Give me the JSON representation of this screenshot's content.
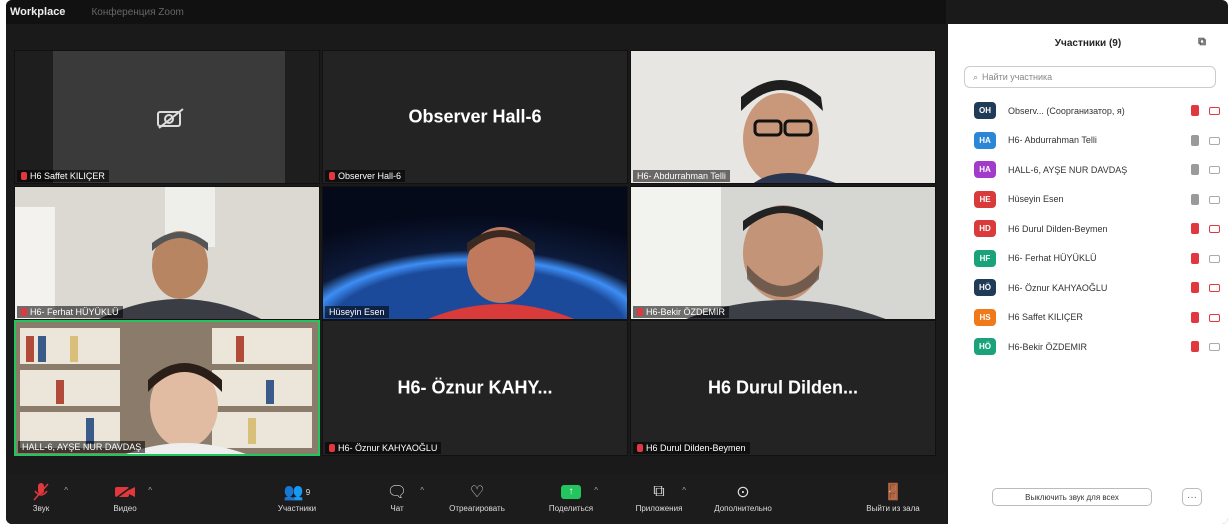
{
  "window": {
    "title": "Workplace",
    "meeting_title": "Конференция Zoom"
  },
  "tiles": [
    {
      "name": "H6 Saffet KILIÇER",
      "big": "",
      "camera_off_icon": "camera-off-icon"
    },
    {
      "name": "Observer Hall-6",
      "big": "Observer  Hall-6"
    },
    {
      "name": "H6- Abdurrahman Telli",
      "big": ""
    },
    {
      "name": "H6- Ferhat HÜYÜKLÜ",
      "big": ""
    },
    {
      "name": "Hüseyin Esen",
      "big": ""
    },
    {
      "name": "H6-Bekir ÖZDEMIR",
      "big": ""
    },
    {
      "name": "HALL-6, AYŞE NUR DAVDAŞ",
      "big": ""
    },
    {
      "name": "H6- Öznur KAHYAOĞLU",
      "big": "H6- Öznur KAHY..."
    },
    {
      "name": "H6 Durul Dilden-Beymen",
      "big": "H6 Durul Dilden..."
    }
  ],
  "toolbar": {
    "audio": "Звук",
    "video": "Видео",
    "participants": "Участники",
    "participants_count": "9",
    "chat": "Чат",
    "react": "Отреагировать",
    "share": "Поделиться",
    "apps": "Приложения",
    "more": "Дополнительно",
    "leave": "Выйти из зала"
  },
  "panel": {
    "title": "Участники (9)",
    "search_placeholder": "Найти участника",
    "mute_all": "Выключить звук для всех",
    "more": "···",
    "participants": [
      {
        "initials": "OH",
        "name": "Observ... (Соорганизатор, я)",
        "color": "#1f3b57",
        "muted": true,
        "cam_off": true
      },
      {
        "initials": "HA",
        "name": "H6- Abdurrahman Telli",
        "color": "#2b86d6",
        "muted": false,
        "cam_off": false
      },
      {
        "initials": "HA",
        "name": "HALL-6, AYŞE NUR DAVDAŞ",
        "color": "#a23bc9",
        "muted": false,
        "cam_off": false
      },
      {
        "initials": "HE",
        "name": "Hüseyin Esen",
        "color": "#d93a3a",
        "muted": false,
        "cam_off": false
      },
      {
        "initials": "HD",
        "name": "H6 Durul Dilden-Beymen",
        "color": "#d93a3a",
        "muted": true,
        "cam_off": true
      },
      {
        "initials": "HF",
        "name": "H6- Ferhat HÜYÜKLÜ",
        "color": "#1aa37a",
        "muted": true,
        "cam_off": false
      },
      {
        "initials": "HÖ",
        "name": "H6- Öznur KAHYAOĞLU",
        "color": "#1f3b57",
        "muted": true,
        "cam_off": true
      },
      {
        "initials": "HS",
        "name": "H6 Saffet KILIÇER",
        "color": "#f07a1a",
        "muted": true,
        "cam_off": true
      },
      {
        "initials": "HÖ",
        "name": "H6-Bekir ÖZDEMIR",
        "color": "#1aa37a",
        "muted": true,
        "cam_off": false
      }
    ]
  }
}
